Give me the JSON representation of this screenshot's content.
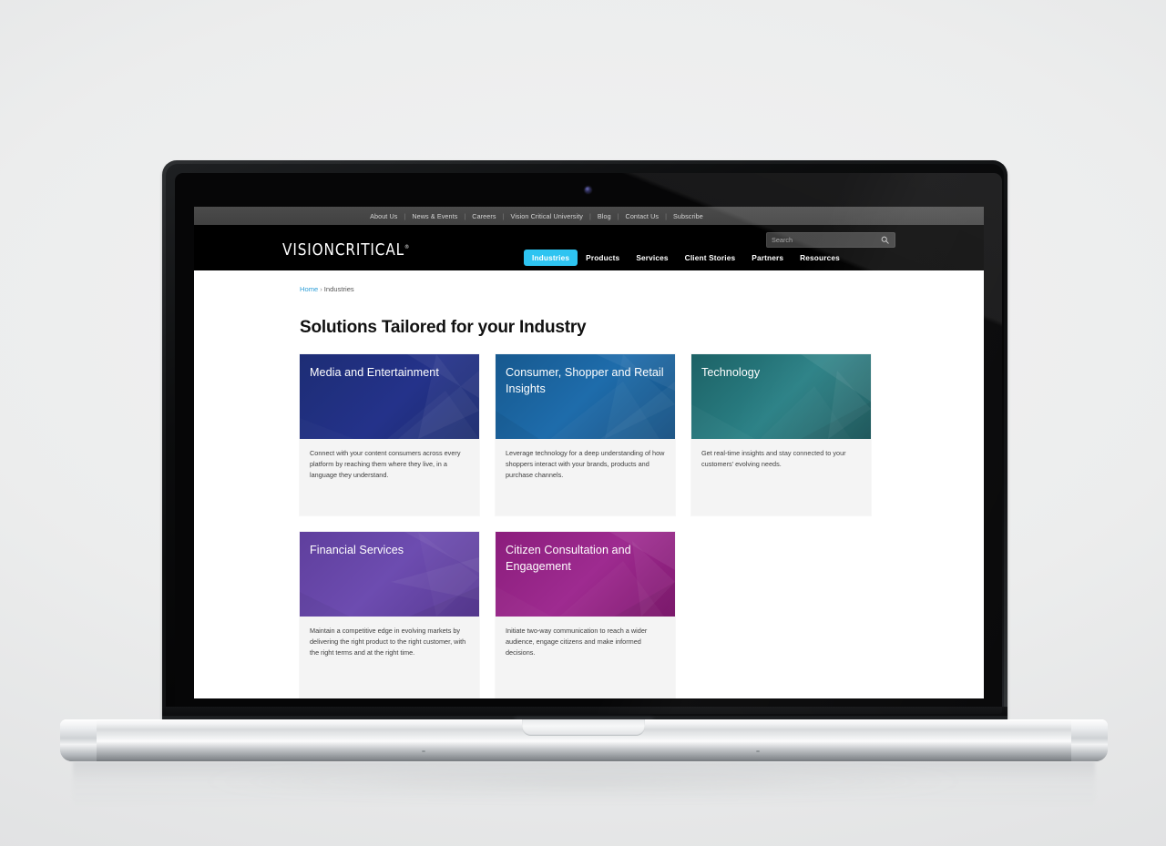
{
  "device": {
    "type": "laptop",
    "camera_label": "webcam"
  },
  "browser": {
    "site_name": "Vision Critical"
  },
  "utility_nav": {
    "items": [
      {
        "label": "About Us"
      },
      {
        "label": "News & Events"
      },
      {
        "label": "Careers"
      },
      {
        "label": "Vision Critical University"
      },
      {
        "label": "Blog"
      },
      {
        "label": "Contact Us"
      },
      {
        "label": "Subscribe"
      }
    ],
    "separator": "|"
  },
  "masthead": {
    "logo_text": "VISIONCRITICAL",
    "logo_registered": "®",
    "search": {
      "placeholder": "Search",
      "value": "",
      "icon": "search-icon"
    },
    "nav": [
      {
        "label": "Industries",
        "active": true
      },
      {
        "label": "Products",
        "active": false
      },
      {
        "label": "Services",
        "active": false
      },
      {
        "label": "Client Stories",
        "active": false
      },
      {
        "label": "Partners",
        "active": false
      },
      {
        "label": "Resources",
        "active": false
      }
    ],
    "accent_color": "#2ec4f1"
  },
  "breadcrumb": {
    "home_label": "Home",
    "separator": "›",
    "current_label": "Industries"
  },
  "main": {
    "page_title": "Solutions Tailored for your Industry",
    "cards": [
      {
        "title": "Media and Entertainment",
        "description": "Connect with your content consumers across every platform by reaching them where they live, in a language they understand.",
        "color": "#1e2f7a",
        "color2": "#23307e"
      },
      {
        "title": "Consumer, Shopper and Retail Insights",
        "description": "Leverage technology for a deep understanding of how shoppers interact with your brands, products and purchase channels.",
        "color": "#175a94",
        "color2": "#1d6aa8"
      },
      {
        "title": "Technology",
        "description": "Get real-time insights and stay connected to your customers' evolving needs.",
        "color": "#1f6468",
        "color2": "#2a7c80"
      },
      {
        "title": "Financial Services",
        "description": "Maintain a competitive edge in evolving markets by delivering the right product to the right customer, with the right terms and at the right time.",
        "color": "#61409e",
        "color2": "#6b4aab"
      },
      {
        "title": "Citizen Consultation and Engagement",
        "description": "Initiate two-way communication to reach a wider audience, engage citizens and make informed decisions.",
        "color": "#8d1e7e",
        "color2": "#9c2a8d"
      }
    ]
  }
}
